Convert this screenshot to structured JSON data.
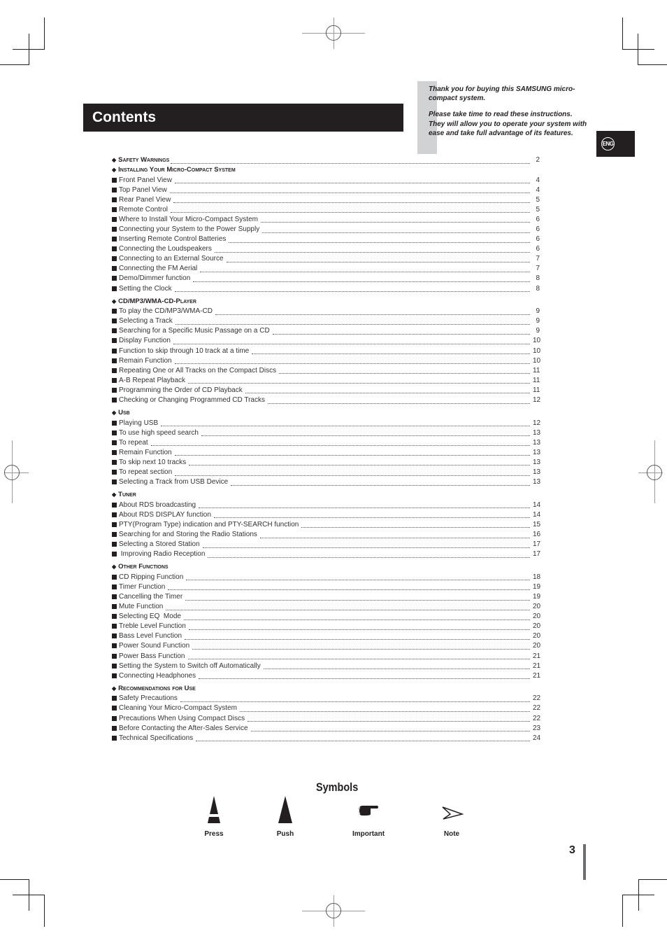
{
  "header": {
    "title": "Contents",
    "intro_lines": [
      "Thank you for buying this SAMSUNG micro-compact system.",
      "Please take time to read these instructions. They will allow you to operate your system with ease and take full advantage of its features."
    ],
    "language_badge": "ENG"
  },
  "toc": [
    {
      "title": "Safety Warnings",
      "page": "2",
      "items": []
    },
    {
      "title": "Installing Your Micro-Compact System",
      "page": "",
      "items": [
        {
          "label": "Front Panel View",
          "page": "4"
        },
        {
          "label": "Top Panel View",
          "page": "4"
        },
        {
          "label": "Rear Panel View",
          "page": "5"
        },
        {
          "label": "Remote Control",
          "page": "5"
        },
        {
          "label": "Where to Install Your Micro-Compact System",
          "page": "6"
        },
        {
          "label": "Connecting your System to the Power Supply",
          "page": "6"
        },
        {
          "label": "Inserting Remote Control Batteries",
          "page": "6"
        },
        {
          "label": "Connecting the Loudspeakers",
          "page": "6"
        },
        {
          "label": "Connecting to an External Source",
          "page": "7"
        },
        {
          "label": "Connecting the FM Aerial",
          "page": "7"
        },
        {
          "label": "Demo/Dimmer function",
          "page": "8"
        },
        {
          "label": "Setting the Clock",
          "page": "8"
        }
      ]
    },
    {
      "title": "CD/MP3/WMA-CD-Player",
      "page": "",
      "items": [
        {
          "label": "To play the CD/MP3/WMA-CD",
          "page": "9"
        },
        {
          "label": "Selecting a Track",
          "page": "9"
        },
        {
          "label": "Searching for a Specific Music Passage on a CD",
          "page": "9"
        },
        {
          "label": "Display Function",
          "page": "10"
        },
        {
          "label": "Function to skip through 10 track at a time",
          "page": "10"
        },
        {
          "label": "Remain Function",
          "page": "10"
        },
        {
          "label": "Repeating One or All Tracks on the Compact Discs",
          "page": "11"
        },
        {
          "label": "A-B Repeat Playback",
          "page": "11"
        },
        {
          "label": "Programming the Order of CD Playback",
          "page": "11"
        },
        {
          "label": "Checking or Changing Programmed CD Tracks",
          "page": "12"
        }
      ]
    },
    {
      "title": "Usb",
      "page": "",
      "items": [
        {
          "label": "Playing USB",
          "page": "12"
        },
        {
          "label": "To use high speed search",
          "page": "13"
        },
        {
          "label": "To repeat",
          "page": "13"
        },
        {
          "label": "Remain Function",
          "page": "13"
        },
        {
          "label": "To skip next 10 tracks",
          "page": "13"
        },
        {
          "label": "To repeat section",
          "page": "13"
        },
        {
          "label": "Selecting a Track from USB Device",
          "page": "13"
        }
      ]
    },
    {
      "title": "Tuner",
      "page": "",
      "items": [
        {
          "label": "About RDS broadcasting",
          "page": "14"
        },
        {
          "label": "About RDS DISPLAY function",
          "page": "14"
        },
        {
          "label": "PTY(Program Type) indication and PTY-SEARCH function",
          "page": "15"
        },
        {
          "label": "Searching for and Storing the Radio Stations",
          "page": "16"
        },
        {
          "label": "Selecting a Stored Station",
          "page": "17"
        },
        {
          "label": " Improving Radio Reception",
          "page": "17"
        }
      ]
    },
    {
      "title": "Other Functions",
      "page": "",
      "items": [
        {
          "label": "CD Ripping Function",
          "page": "18"
        },
        {
          "label": "Timer Function",
          "page": "19"
        },
        {
          "label": "Cancelling the Timer",
          "page": "19"
        },
        {
          "label": "Mute Function",
          "page": "20"
        },
        {
          "label": "Selecting EQ  Mode",
          "page": "20"
        },
        {
          "label": "Treble Level Function",
          "page": "20"
        },
        {
          "label": "Bass Level Function",
          "page": "20"
        },
        {
          "label": "Power Sound Function",
          "page": "20"
        },
        {
          "label": "Power Bass Function",
          "page": "21"
        },
        {
          "label": "Setting the System to Switch off Automatically",
          "page": "21"
        },
        {
          "label": "Connecting Headphones",
          "page": "21"
        }
      ]
    },
    {
      "title": "Recommendations for Use",
      "page": "",
      "items": [
        {
          "label": "Safety Precautions",
          "page": "22"
        },
        {
          "label": "Cleaning Your Micro-Compact System",
          "page": "22"
        },
        {
          "label": "Precautions When Using Compact Discs",
          "page": "22"
        },
        {
          "label": "Before Contacting the After-Sales Service",
          "page": "23"
        },
        {
          "label": "Technical Specifications",
          "page": "24"
        }
      ]
    }
  ],
  "symbols": {
    "title": "Symbols",
    "items": [
      {
        "label": "Press",
        "icon": "press-icon"
      },
      {
        "label": "Push",
        "icon": "push-icon"
      },
      {
        "label": "Important",
        "icon": "pointing-hand-icon"
      },
      {
        "label": "Note",
        "icon": "note-arrow-icon"
      }
    ]
  },
  "footer": {
    "page_number": "3"
  }
}
